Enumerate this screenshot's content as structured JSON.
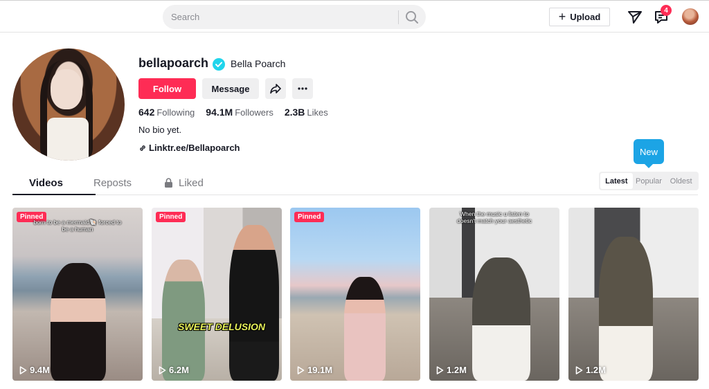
{
  "header": {
    "search_placeholder": "Search",
    "upload_label": "Upload",
    "inbox_badge": "4"
  },
  "profile": {
    "username": "bellapoarch",
    "nickname": "Bella Poarch",
    "follow_label": "Follow",
    "message_label": "Message",
    "stats": [
      {
        "value": "642",
        "label": "Following"
      },
      {
        "value": "94.1M",
        "label": "Followers"
      },
      {
        "value": "2.3B",
        "label": "Likes"
      }
    ],
    "bio": "No bio yet.",
    "link": "Linktr.ee/Bellapoarch"
  },
  "tabs": {
    "videos": "Videos",
    "reposts": "Reposts",
    "liked": "Liked"
  },
  "sort": {
    "new_tooltip": "New",
    "options": [
      "Latest",
      "Popular",
      "Oldest"
    ],
    "selected": "Latest"
  },
  "videos": [
    {
      "pinned": "Pinned",
      "caption": "born to be a mermaid🐚 forced to be a human",
      "overlay": "",
      "views": "9.4M"
    },
    {
      "pinned": "Pinned",
      "caption": "",
      "overlay": "SWEET DELUSION",
      "views": "6.2M"
    },
    {
      "pinned": "Pinned",
      "caption": "",
      "overlay": "",
      "views": "19.1M"
    },
    {
      "pinned": "",
      "caption": "When the music u listen to doesn't match your aesthetic",
      "overlay": "",
      "views": "1.2M"
    },
    {
      "pinned": "",
      "caption": "",
      "overlay": "",
      "views": "1.2M"
    }
  ],
  "colors": {
    "accent": "#fe2c55",
    "tooltip": "#1ca4e5",
    "verified": "#20d5ec"
  }
}
